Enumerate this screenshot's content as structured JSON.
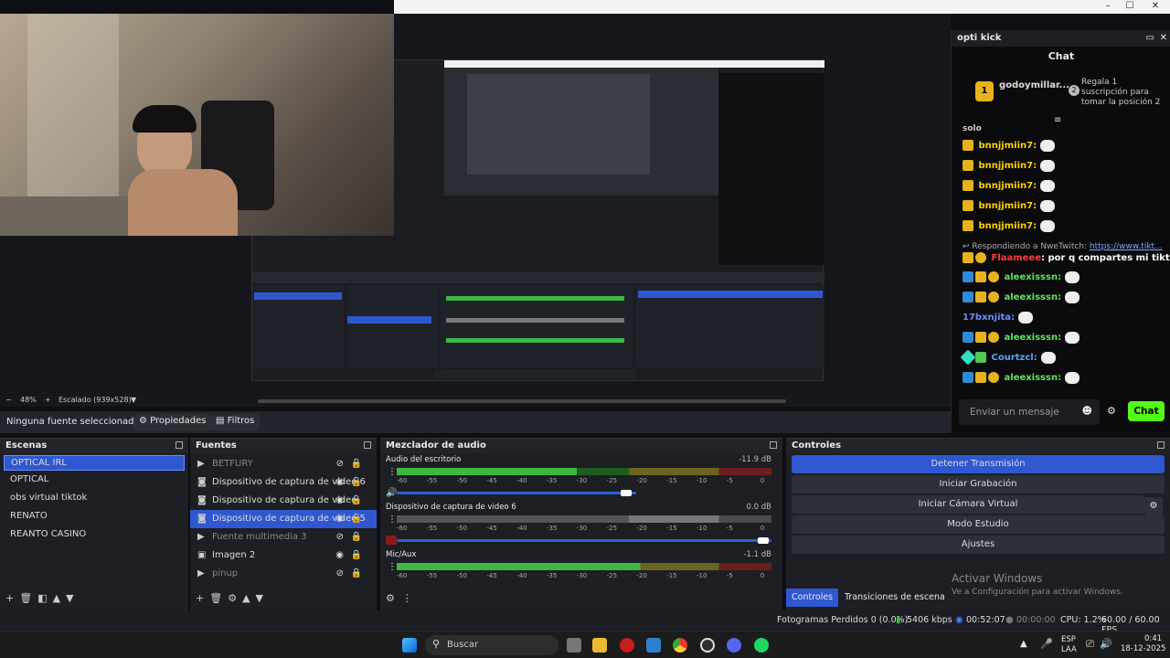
{
  "window": {
    "min": "–",
    "max": "☐",
    "close": "✕"
  },
  "preview": {
    "zoom": "48%",
    "scale": "Escalado (939x528)"
  },
  "chat": {
    "title": "opti kick",
    "heading": "Chat",
    "pinned_user": "godoymillar...",
    "pinned_rank": "1",
    "pinned_rank2": "2",
    "pinned_text": "Regala 1 suscripción para tomar la posición 2",
    "partial": "solo",
    "messages": [
      {
        "user": "bnnjjmiin7:",
        "color": "#ffd400"
      },
      {
        "user": "bnnjjmiin7:",
        "color": "#ffd400"
      },
      {
        "user": "bnnjjmiin7:",
        "color": "#ffd400"
      },
      {
        "user": "bnnjjmiin7:",
        "color": "#ffd400"
      },
      {
        "user": "bnnjjmiin7:",
        "color": "#ffd400"
      }
    ],
    "reply_label": "Respondiendo a NweTwitch:",
    "reply_link": "https://www.tikt...",
    "reply_user": "Flaameee",
    "reply_text": ": por q compartes mi tiktok",
    "msgs2": [
      {
        "user": "aleexisssn:",
        "color": "#5ce65c"
      },
      {
        "user": "aleexisssn:",
        "color": "#5ce65c"
      },
      {
        "user": "17bxnjita:",
        "color": "#6a8cff"
      },
      {
        "user": "aleexisssn:",
        "color": "#5ce65c"
      },
      {
        "user": "Courtzcl:",
        "color": "#5aa0ff"
      },
      {
        "user": "aleexisssn:",
        "color": "#5ce65c"
      }
    ],
    "input_placeholder": "Enviar un mensaje",
    "send": "Chat"
  },
  "source_toolbar": {
    "no_source": "Ninguna fuente seleccionad",
    "properties": "Propiedades",
    "filters": "Filtros"
  },
  "scenes": {
    "title": "Escenas",
    "items": [
      "OPTICAL IRL",
      "OPTICAL",
      "obs virtual tiktok",
      "RENATO",
      "REANTO CASINO"
    ]
  },
  "sources": {
    "title": "Fuentes",
    "items": [
      {
        "name": "BETFURY",
        "icon": "▶",
        "dim": true
      },
      {
        "name": "Dispositivo de captura de video 6",
        "icon": "◙",
        "dim": false
      },
      {
        "name": "Dispositivo de captura de video",
        "icon": "◙",
        "dim": false
      },
      {
        "name": "Dispositivo de captura de video 5",
        "icon": "◙",
        "dim": false,
        "selected": true
      },
      {
        "name": "Fuente multimedia 3",
        "icon": "▶",
        "dim": true
      },
      {
        "name": "Imagen 2",
        "icon": "▣",
        "dim": false
      },
      {
        "name": "pinup",
        "icon": "▶",
        "dim": true
      }
    ]
  },
  "mixer": {
    "title": "Mezclador de audio",
    "channels": [
      {
        "name": "Audio del escritorio",
        "db": "-11.9 dB",
        "level": 0.62
      },
      {
        "name": "Dispositivo de captura de video 6",
        "db": "0.0 dB",
        "level": 0.0
      },
      {
        "name": "Mic/Aux",
        "db": "-1.1 dB",
        "level": 0.7
      }
    ],
    "scale": [
      "-60",
      "-55",
      "-50",
      "-45",
      "-40",
      "-35",
      "-30",
      "-25",
      "-20",
      "-15",
      "-10",
      "-5",
      "0"
    ]
  },
  "controls": {
    "title": "Controles",
    "buttons": [
      "Detener Transmisión",
      "Iniciar Grabación",
      "Iniciar Cámara Virtual",
      "Modo Estudio",
      "Ajustes"
    ],
    "tab1": "Controles",
    "tab2": "Transiciones de escena",
    "watermark1": "Activar Windows",
    "watermark2": "Ve a Configuración para activar Windows."
  },
  "status": {
    "dropped": "Fotogramas Perdidos 0 (0.0%)",
    "kbps": "5406 kbps",
    "stream_time": "00:52:07",
    "rec_time": "00:00:00",
    "cpu": "CPU: 1.2%",
    "fps": "60.00 / 60.00 FPS"
  },
  "taskbar": {
    "search": "Buscar",
    "lang1": "ESP",
    "lang2": "LAA",
    "time": "0:41",
    "date": "18-12-2025"
  }
}
